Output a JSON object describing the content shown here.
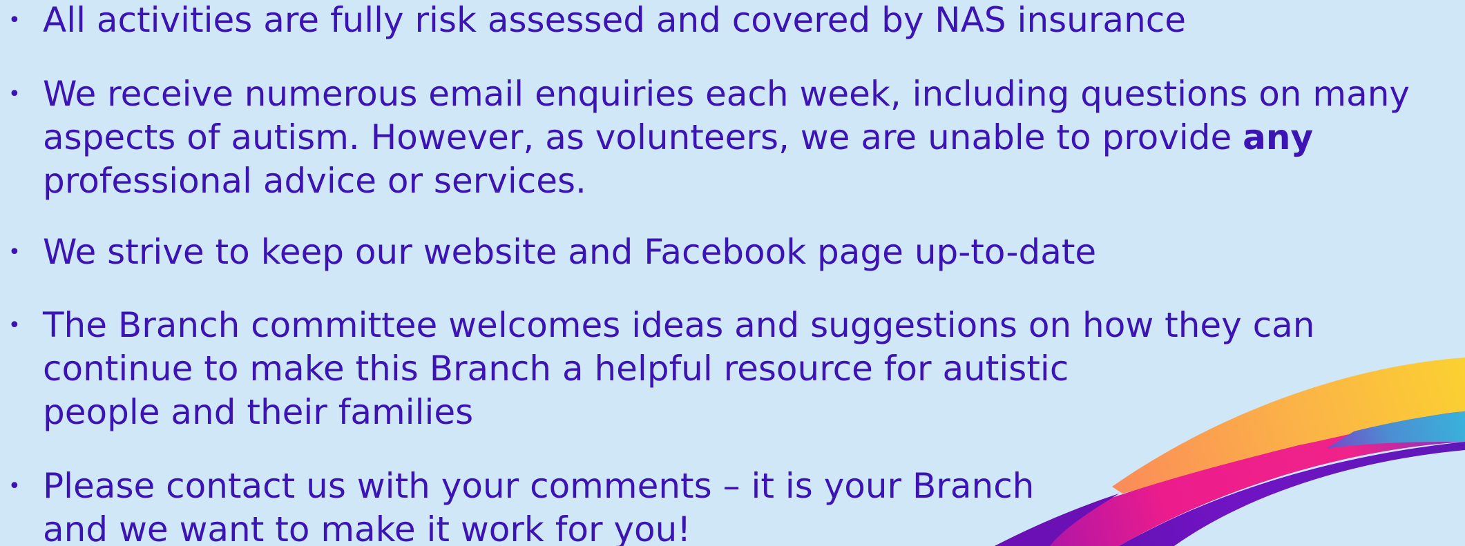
{
  "slide": {
    "bullets": [
      {
        "lines": [
          "All activities are fully risk assessed and covered by NAS insurance"
        ]
      },
      {
        "lines": [
          "We receive numerous email enquiries each week, including questions on many",
          "aspects of autism. However, as volunteers, we are unable to provide",
          "professional advice or services."
        ],
        "emphasis": "any"
      },
      {
        "lines": [
          "We strive to keep our website and Facebook page up-to-date"
        ]
      },
      {
        "lines": [
          "The Branch committee welcomes ideas and suggestions on how they can",
          "continue to make this Branch a helpful resource for autistic",
          "people and their families"
        ]
      },
      {
        "lines": [
          "Please contact us with your comments – it is your Branch",
          "and we want to make it work for you!"
        ]
      }
    ],
    "bullet_symbol": "•",
    "colors": {
      "background": "#d0e7f8",
      "text": "#3c14b4",
      "swoosh_yellow": "#fbd131",
      "swoosh_orange": "#fb9a4f",
      "swoosh_magenta": "#ec1c8c",
      "swoosh_purple": "#6712c0",
      "swoosh_blue": "#3ba8d8"
    }
  }
}
